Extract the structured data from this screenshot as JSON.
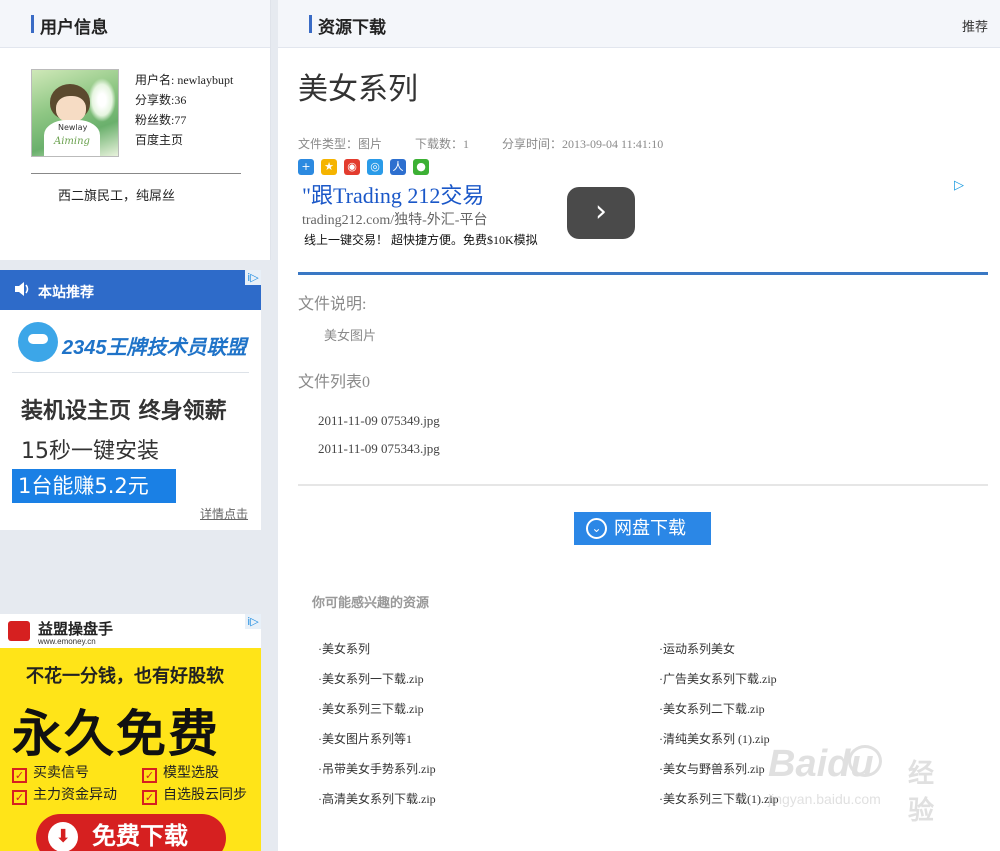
{
  "sidebar": {
    "user_panel": {
      "title": "用户信息",
      "username_line": "用户名: newlaybupt",
      "shares_line": "分享数:36",
      "fans_line": "粉丝数:77",
      "homepage_link": "百度主页",
      "bio": "西二旗民工，纯屌丝",
      "avatar_text_top": "Newlay",
      "avatar_text_bottom": "Aiming"
    },
    "ad_2345": {
      "title": "本站推荐",
      "brand": "2345王牌技术员联盟",
      "line1": "装机设主页 终身领薪",
      "line2": "15秒一键安装",
      "line3": "1台能赚5.2元",
      "more_link": "详情点击",
      "ad_mark": "i▷"
    },
    "ad_emoney": {
      "brand": "益盟操盘手",
      "url": "www.emoney.cn",
      "slogan": "不花一分钱，也有好股软",
      "headline": "永久免费",
      "features": [
        "买卖信号",
        "模型选股",
        "主力资金异动",
        "自选股云同步"
      ],
      "button": "免费下载",
      "ad_mark": "i▷"
    }
  },
  "main": {
    "header": {
      "title": "资源下载",
      "right_link": "推荐"
    },
    "page_title": "美女系列",
    "meta": {
      "file_type": "文件类型：图片",
      "downloads": "下载数：1",
      "share_time": "分享时间：2013-09-04 11:41:10"
    },
    "share_icons": [
      "share-more-icon",
      "qzone-icon",
      "weibo-icon",
      "tencent-weibo-icon",
      "renren-icon",
      "wechat-icon"
    ],
    "ad": {
      "title": "\"跟Trading 212交易",
      "url": "trading212.com/独特-外汇-平台",
      "desc": "线上一键交易！ 超快捷方便。免费$10K模拟",
      "arrow": "›",
      "mark": "▷"
    },
    "file_desc_label": "文件说明:",
    "file_desc": "美女图片",
    "file_list_label": "文件列表0",
    "files": [
      "2011-11-09 075349.jpg",
      "2011-11-09 075343.jpg"
    ],
    "download_button": "网盘下载",
    "related_title": "你可能感兴趣的资源",
    "related_left": [
      "·美女系列",
      "·美女系列一下载.zip",
      "·美女系列三下载.zip",
      "·美女图片系列等1",
      "·吊带美女手势系列.zip",
      "·高清美女系列下载.zip"
    ],
    "related_right": [
      "·运动系列美女",
      "·广告美女系列下载.zip",
      "·美女系列二下载.zip",
      "·清纯美女系列 (1).zip",
      "·美女与野兽系列.zip",
      "·美女系列三下载(1).zip"
    ]
  },
  "watermark": {
    "brand": "Baidu",
    "suffix": "经验",
    "url": "jingyan.baidu.com"
  },
  "colors": {
    "accent": "#3a6bc5",
    "link_blue": "#1a57c8",
    "button_blue": "#2b87e6",
    "ad_yellow": "#ffe418",
    "ad_red": "#d62020"
  }
}
